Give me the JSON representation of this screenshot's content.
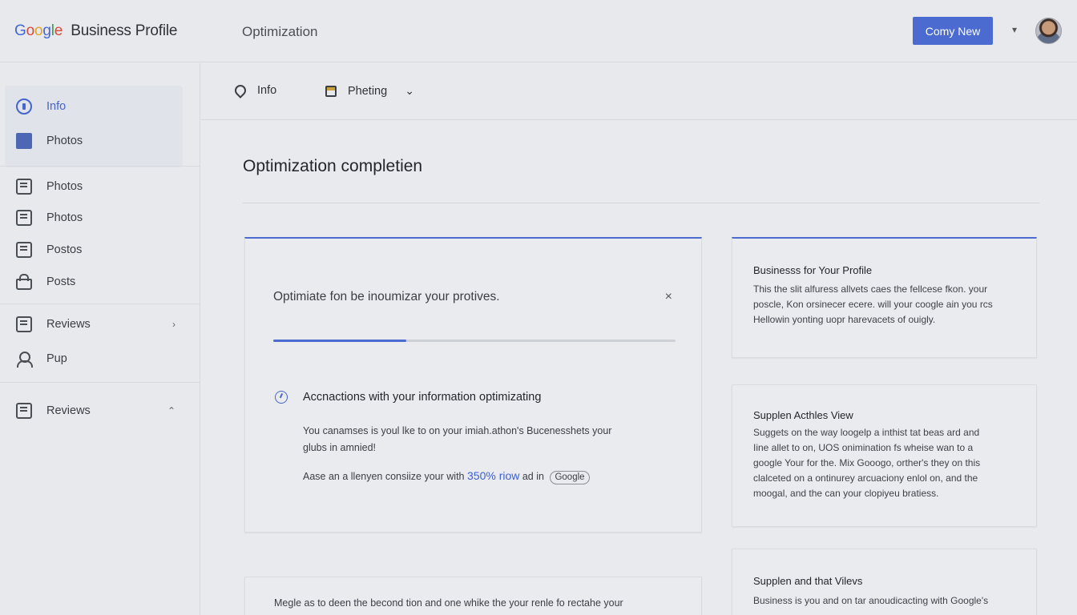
{
  "header": {
    "brand_google": "Google",
    "brand_rest": "Business Profile",
    "title": "Optimization",
    "primary_button": "Comy New",
    "menu_caret": "▾",
    "avatar_icon": "user-avatar"
  },
  "sidebar": {
    "items": [
      {
        "label": "Info",
        "icon": "info-icon"
      },
      {
        "label": "Photos",
        "icon": "photo-icon"
      },
      {
        "label": "Photos",
        "icon": "document-icon"
      },
      {
        "label": "Photos",
        "icon": "image-icon"
      },
      {
        "label": "Postos",
        "icon": "post-icon"
      },
      {
        "label": "Posts",
        "icon": "lock-icon"
      },
      {
        "label": "Reviews",
        "icon": "review-icon",
        "chevron": "›"
      },
      {
        "label": "Pup",
        "icon": "person-icon"
      },
      {
        "label": "Reviews",
        "icon": "review-icon",
        "chevron": "⌃"
      }
    ]
  },
  "tabs": {
    "info": "Info",
    "photos": "Pheting",
    "chevron": "⌄"
  },
  "main": {
    "section_title": "Optimization completien",
    "card": {
      "prompt": "Optimiate fon be inoumizar your protives.",
      "close": "×",
      "progress": 0.33,
      "subtitle": "Accnactions with your information optimizating",
      "body1_line1": "You canamses is youl lke to on your imiah.athon's Bucenesshets your",
      "body1_line2": "glubs in amnied!",
      "body2_prefix": "Aase an a llenyen consiize your with",
      "body2_highlight": "350% riow",
      "body2_mid": "ad in",
      "body2_pill": "Google"
    },
    "bottom_card_text": "Megle as to deen the becond tion and one whike the your renle fo rectahe your"
  },
  "side_cards": [
    {
      "title": "Businesss for Your Profile",
      "lines": [
        "This the slit alfuress allvets caes the fellcese fkon. your",
        "poscle, Kon orsinecer ecere. will your coogle ain you rcs",
        "Hellowin yonting uopr harevacets of ouigly."
      ]
    },
    {
      "title": "Supplen Acthles View",
      "lines": [
        "Suggets on the way loogelp a inthist tat beas ard and",
        "Iine allet to on, UOS onimination fs wheise wan to a",
        "google Your for the. Mix Gooogo, orther's they on this",
        "clalceted on a ontinurey arcuaciony enlol on, and the",
        "moogal, and the can your clopiyeu bratiess."
      ]
    },
    {
      "title": "Supplen and that Vilevs",
      "lines": [
        "Business is you and on tar anoudicacting with Google's"
      ]
    }
  ],
  "colors": {
    "accent": "#4c6bd0",
    "background": "#e9eaee"
  }
}
